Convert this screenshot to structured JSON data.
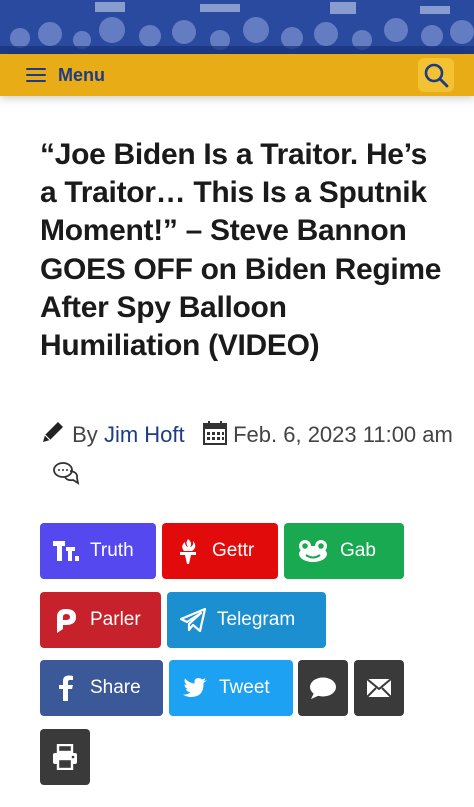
{
  "nav": {
    "menu_label": "Menu"
  },
  "article": {
    "title": "“Joe Biden Is a Traitor. He’s a Traitor… This Is a Sputnik Moment!” – Steve Bannon GOES OFF on Biden Regime After Spy Balloon Humiliation (VIDEO)",
    "by_label": "By",
    "author": "Jim Hoft",
    "date": "Feb. 6, 2023 11:00 am"
  },
  "share": {
    "truth": "Truth",
    "gettr": "Gettr",
    "gab": "Gab",
    "parler": "Parler",
    "telegram": "Telegram",
    "facebook": "Share",
    "twitter": "Tweet"
  },
  "colors": {
    "nav_bg": "#e8ac16",
    "brand_blue": "#1d3b86",
    "truth": "#5448ee",
    "gettr": "#e10b0b",
    "gab": "#19a950",
    "parler": "#c7212c",
    "telegram": "#1b8fd0",
    "facebook": "#3b5998",
    "twitter": "#1da1f2",
    "dark_btn": "#3a3a3a"
  },
  "icons": [
    "hamburger-icon",
    "search-icon",
    "pencil-icon",
    "calendar-icon",
    "comments-icon",
    "truth-icon",
    "gettr-icon",
    "gab-icon",
    "parler-icon",
    "telegram-icon",
    "facebook-icon",
    "twitter-icon",
    "comment-icon",
    "email-icon",
    "print-icon"
  ]
}
